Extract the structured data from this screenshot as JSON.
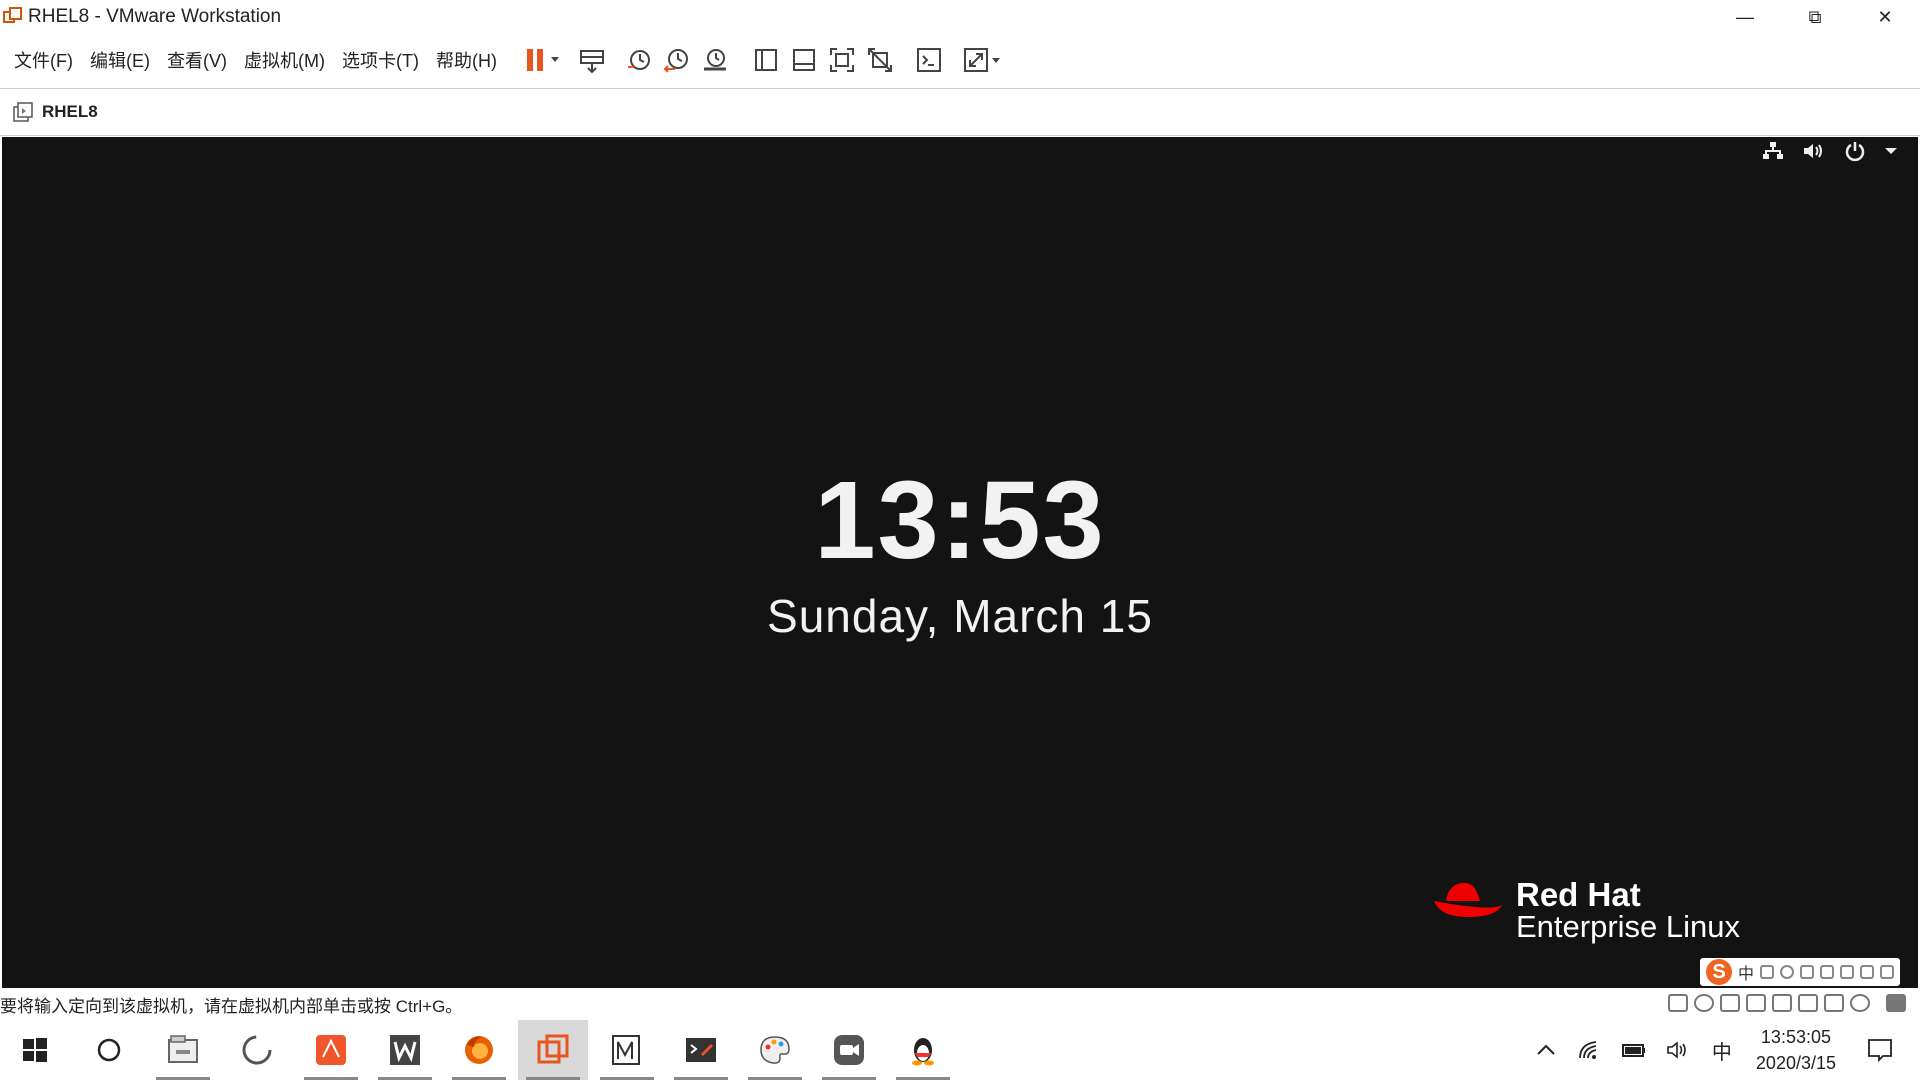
{
  "window": {
    "title": "RHEL8 - VMware Workstation",
    "minimize": "—",
    "restore": "⧉",
    "close": "✕"
  },
  "menu": [
    "文件(F)",
    "编辑(E)",
    "查看(V)",
    "虚拟机(M)",
    "选项卡(T)",
    "帮助(H)"
  ],
  "toolbar_icons": [
    "pause-icon",
    "send-ctrl-alt-del-icon",
    "snapshot-icon",
    "revert-snapshot-icon",
    "snapshot-manager-icon",
    "show-library-icon",
    "show-thumbnails-icon",
    "full-screen-icon",
    "unity-icon",
    "console-icon",
    "stretch-guest-icon"
  ],
  "tab": {
    "label": "RHEL8"
  },
  "vm": {
    "time": "13:53",
    "date": "Sunday, March 15",
    "brand": "Red Hat",
    "product": "Enterprise Linux",
    "ime_logo": "S",
    "ime_mode": "中"
  },
  "statusbar": {
    "message": "要将输入定向到该虚拟机，请在虚拟机内部单击或按 Ctrl+G。"
  },
  "taskbar": {
    "apps": [
      "start",
      "cortana-search",
      "file-explorer",
      "loading-app",
      "pdf-reader",
      "word",
      "firefox",
      "vmware-workstation",
      "editor",
      "terminal",
      "paint",
      "zoom",
      "qq"
    ],
    "ime_indicator": "中",
    "time": "13:53:05",
    "date": "2020/3/15"
  },
  "colors": {
    "vm_background": "#141314",
    "redhat_red": "#ee0000",
    "vmware_accent": "#d35400"
  }
}
